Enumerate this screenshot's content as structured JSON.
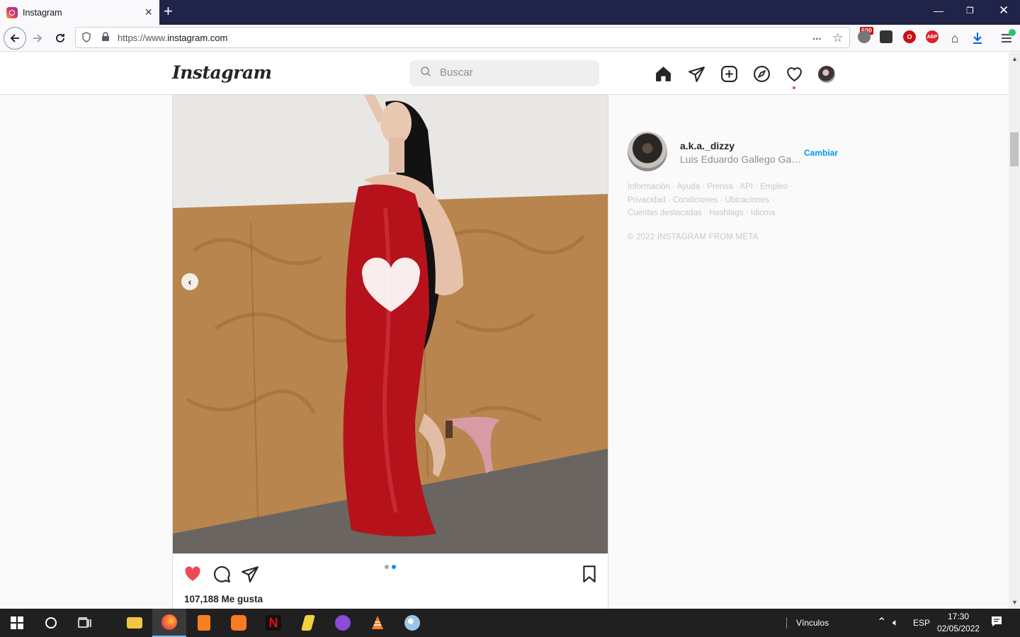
{
  "browser": {
    "tab_title": "Instagram",
    "url_prefix": "https://www.",
    "url_domain": "instagram.com",
    "more_icon": "...",
    "notification_badge": "600",
    "extension_adblock": "ABP"
  },
  "instagram": {
    "logo": "Instagram",
    "search_placeholder": "Buscar",
    "post": {
      "likes": "107,188 Me gusta",
      "carousel_total": 2,
      "carousel_active": 2
    },
    "sidebar": {
      "username": "a.k.a._dizzy",
      "full_name": "Luis Eduardo Gallego Garcia",
      "switch_label": "Cambiar",
      "footer_links": [
        "Información",
        "Ayuda",
        "Prensa",
        "API",
        "Empleo",
        "Privacidad",
        "Condiciones",
        "Ubicaciones",
        "Cuentas destacadas",
        "Hashtags",
        "Idioma"
      ],
      "copyright": "© 2022 INSTAGRAM FROM META"
    }
  },
  "taskbar": {
    "links_label": "Vínculos",
    "language": "ESP",
    "time": "17:30",
    "date": "02/05/2022"
  },
  "colors": {
    "accent_blue": "#0095f6",
    "like_red": "#ed4956",
    "titlebar": "#1f2448"
  }
}
